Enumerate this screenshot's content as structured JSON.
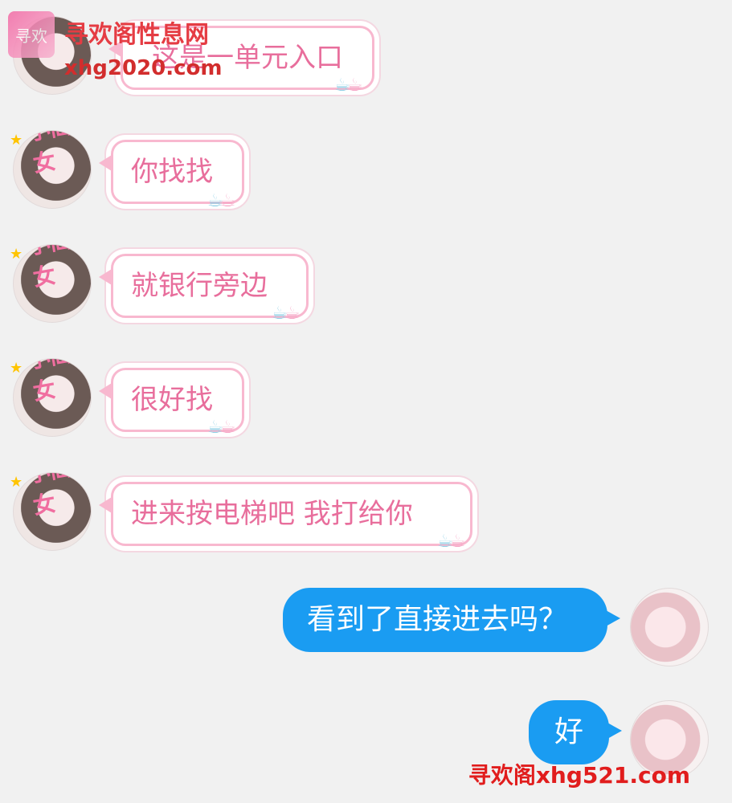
{
  "watermark": {
    "logo_text": "寻欢",
    "title": "寻欢阁性息网",
    "url": "xhg2020.com",
    "footer": "寻欢阁xhg521.com"
  },
  "sticker_text": "小仙女",
  "messages": [
    {
      "side": "left",
      "text": "这是一单元入口"
    },
    {
      "side": "left",
      "text": "你找找"
    },
    {
      "side": "left",
      "text": "就银行旁边"
    },
    {
      "side": "left",
      "text": "很好找"
    },
    {
      "side": "left",
      "text": "进来按电梯吧 我打给你"
    },
    {
      "side": "right",
      "text": "看到了直接进去吗？"
    },
    {
      "side": "right",
      "text": "好"
    }
  ]
}
